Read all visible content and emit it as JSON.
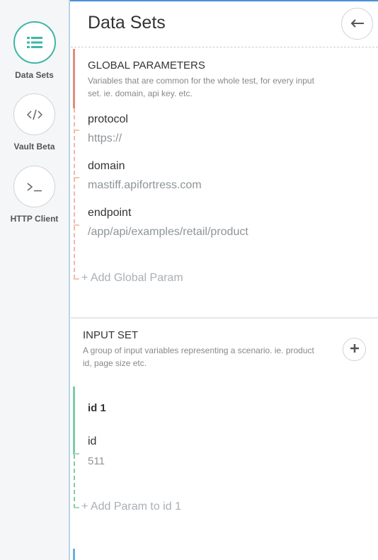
{
  "nav": {
    "items": [
      {
        "label": "Data Sets",
        "icon": "list-icon",
        "active": true
      },
      {
        "label": "Vault Beta",
        "icon": "code-icon",
        "active": false
      },
      {
        "label": "HTTP Client",
        "icon": "terminal-icon",
        "active": false
      }
    ]
  },
  "header": {
    "title": "Data Sets",
    "back_icon": "arrow-left-icon"
  },
  "global": {
    "heading": "GLOBAL PARAMETERS",
    "description": "Variables that are common for the whole test, for every input set. ie. domain, api key. etc.",
    "params": [
      {
        "name": "protocol",
        "value": "https://"
      },
      {
        "name": "domain",
        "value": "mastiff.apifortress.com"
      },
      {
        "name": "endpoint",
        "value": "/app/api/examples/retail/product"
      }
    ],
    "add_label": "+ Add Global Param"
  },
  "input_set": {
    "heading": "INPUT SET",
    "description": "A group of input variables representing a scenario. ie. product id, page size etc.",
    "add_icon": "plus-icon",
    "sets": [
      {
        "title": "id 1",
        "params": [
          {
            "name": "id",
            "value": "511"
          }
        ],
        "add_label": "+ Add Param to id 1"
      }
    ]
  },
  "colors": {
    "accent": "#3fb6a8",
    "global_bar": "#e08e79",
    "input_bar": "#7fcca1",
    "top_line": "#4a90d9"
  }
}
